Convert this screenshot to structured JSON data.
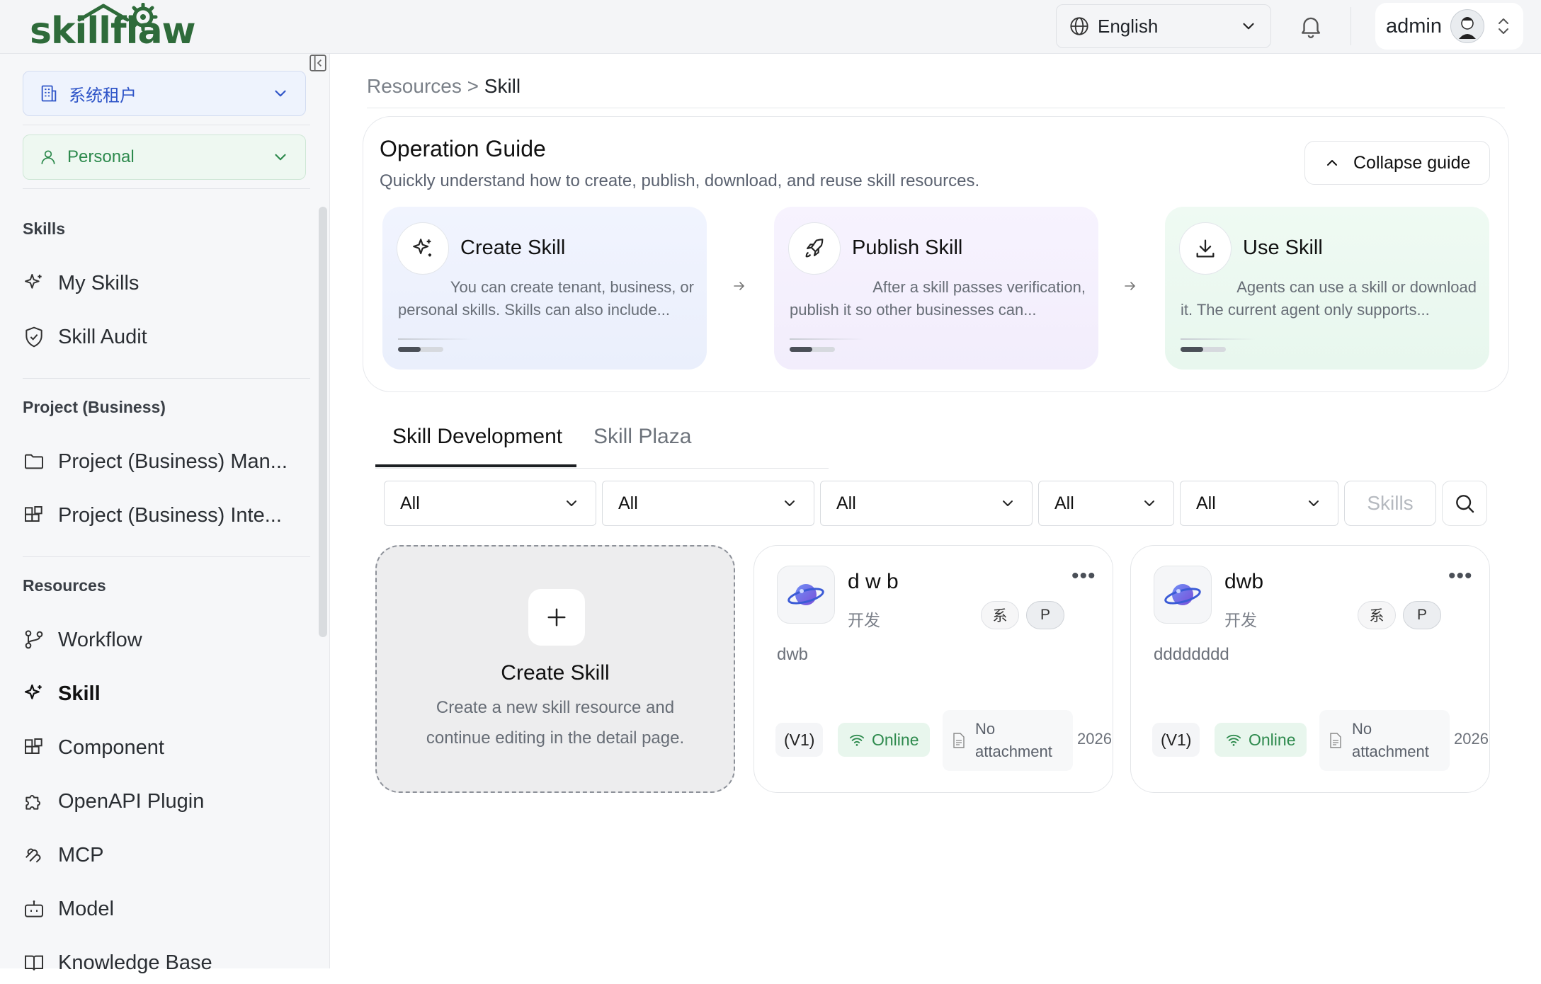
{
  "header": {
    "logo_text": "skillflaw",
    "language": "English",
    "user": "admin",
    "brand_color": "#2e6b3a"
  },
  "sidebar": {
    "tenant": "系统租户",
    "scope": "Personal",
    "sections": [
      {
        "title": "Skills",
        "items": [
          {
            "label": "My Skills",
            "icon": "sparkle-icon"
          },
          {
            "label": "Skill Audit",
            "icon": "shield-check-icon"
          }
        ]
      },
      {
        "title": "Project (Business)",
        "items": [
          {
            "label": "Project (Business) Man...",
            "icon": "folder-icon"
          },
          {
            "label": "Project (Business) Inte...",
            "icon": "blocks-icon"
          }
        ]
      },
      {
        "title": "Resources",
        "items": [
          {
            "label": "Workflow",
            "icon": "workflow-icon"
          },
          {
            "label": "Skill",
            "icon": "sparkle-icon",
            "active": true
          },
          {
            "label": "Component",
            "icon": "blocks-icon"
          },
          {
            "label": "OpenAPI Plugin",
            "icon": "puzzle-icon"
          },
          {
            "label": "MCP",
            "icon": "mcp-icon"
          },
          {
            "label": "Model",
            "icon": "bot-icon"
          },
          {
            "label": "Knowledge Base",
            "icon": "book-icon"
          }
        ]
      }
    ]
  },
  "breadcrumb": {
    "parent": "Resources",
    "separator": ">",
    "current": "Skill"
  },
  "guide": {
    "title": "Operation Guide",
    "subtitle": "Quickly understand how to create, publish, download, and reuse skill resources.",
    "collapse_label": "Collapse guide",
    "steps": [
      {
        "title": "Create Skill",
        "line1": "You can create tenant, business, or",
        "line2": "personal skills. Skills can also include...",
        "icon": "sparkle-icon"
      },
      {
        "title": "Publish Skill",
        "line1": "After a skill passes verification,",
        "line2": "publish it so other businesses can...",
        "icon": "rocket-icon"
      },
      {
        "title": "Use Skill",
        "line1": "Agents can use a skill or download",
        "line2": "it. The current agent only supports...",
        "icon": "download-icon"
      }
    ]
  },
  "tabs": [
    {
      "label": "Skill Development",
      "active": true
    },
    {
      "label": "Skill Plaza",
      "active": false
    }
  ],
  "filters": [
    "All",
    "All",
    "All",
    "All",
    "All"
  ],
  "search": {
    "placeholder": "Skills"
  },
  "create_card": {
    "title": "Create Skill",
    "description": "Create a new skill resource and continue editing in the detail page."
  },
  "skills": [
    {
      "name": "d w b",
      "category": "开发",
      "badge1": "系",
      "badge2": "P",
      "description": "dwb",
      "version": "(V1)",
      "status": "Online",
      "attachment_line1": "No",
      "attachment_line2": "attachment",
      "date": "2026"
    },
    {
      "name": "dwb",
      "category": "开发",
      "badge1": "系",
      "badge2": "P",
      "description": "dddddddd",
      "version": "(V1)",
      "status": "Online",
      "attachment_line1": "No",
      "attachment_line2": "attachment",
      "date": "2026"
    }
  ]
}
